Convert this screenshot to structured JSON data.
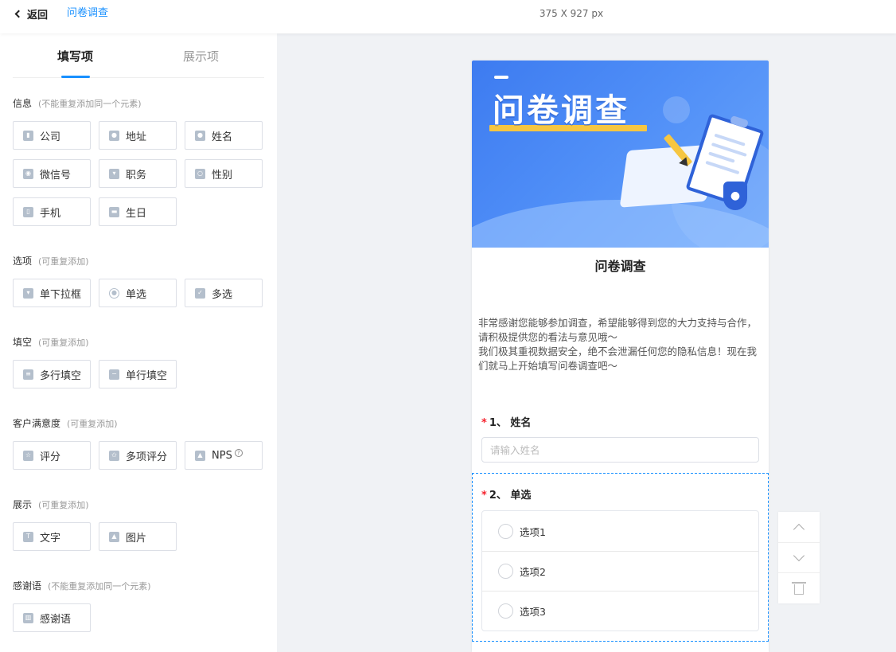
{
  "topbar": {
    "back_label": "返回",
    "breadcrumb": "问卷调查",
    "canvas_size": "375 X 927 px"
  },
  "tabs": {
    "fill": "填写项",
    "display": "展示项"
  },
  "sections": {
    "info": {
      "title": "信息",
      "note": "(不能重复添加同一个元素)"
    },
    "options": {
      "title": "选项",
      "note": "(可重复添加)"
    },
    "blank": {
      "title": "填空",
      "note": "(可重复添加)"
    },
    "satisfaction": {
      "title": "客户满意度",
      "note": "(可重复添加)"
    },
    "display": {
      "title": "展示",
      "note": "(可重复添加)"
    },
    "thanks": {
      "title": "感谢语",
      "note": "(不能重复添加同一个元素)"
    }
  },
  "components": {
    "company": "公司",
    "address": "地址",
    "name": "姓名",
    "wechat": "微信号",
    "position": "职务",
    "gender": "性别",
    "phone": "手机",
    "birthday": "生日",
    "dropdown": "单下拉框",
    "single": "单选",
    "multi": "多选",
    "multiline": "多行填空",
    "singleline": "单行填空",
    "rating": "评分",
    "multirating": "多项评分",
    "nps": "NPS",
    "text": "文字",
    "image": "图片",
    "thanks": "感谢语"
  },
  "form": {
    "banner_title": "问卷调查",
    "title": "问卷调查",
    "desc_line1": "非常感谢您能够参加调查，希望能够得到您的大力支持与合作，请积极提供您的看法与意见哦～",
    "desc_line2": "我们极其重视数据安全，绝不会泄漏任何您的隐私信息！现在我们就马上开始填写问卷调查吧～",
    "q1": {
      "required": "*",
      "label": "1、 姓名",
      "placeholder": "请输入姓名"
    },
    "q2": {
      "required": "*",
      "label": "2、 单选",
      "options": [
        "选项1",
        "选项2",
        "选项3"
      ]
    }
  },
  "colors": {
    "accent": "#1890ff",
    "required": "#f5222d",
    "banner": "#4f8ef7",
    "banner_highlight": "#f6c641"
  }
}
